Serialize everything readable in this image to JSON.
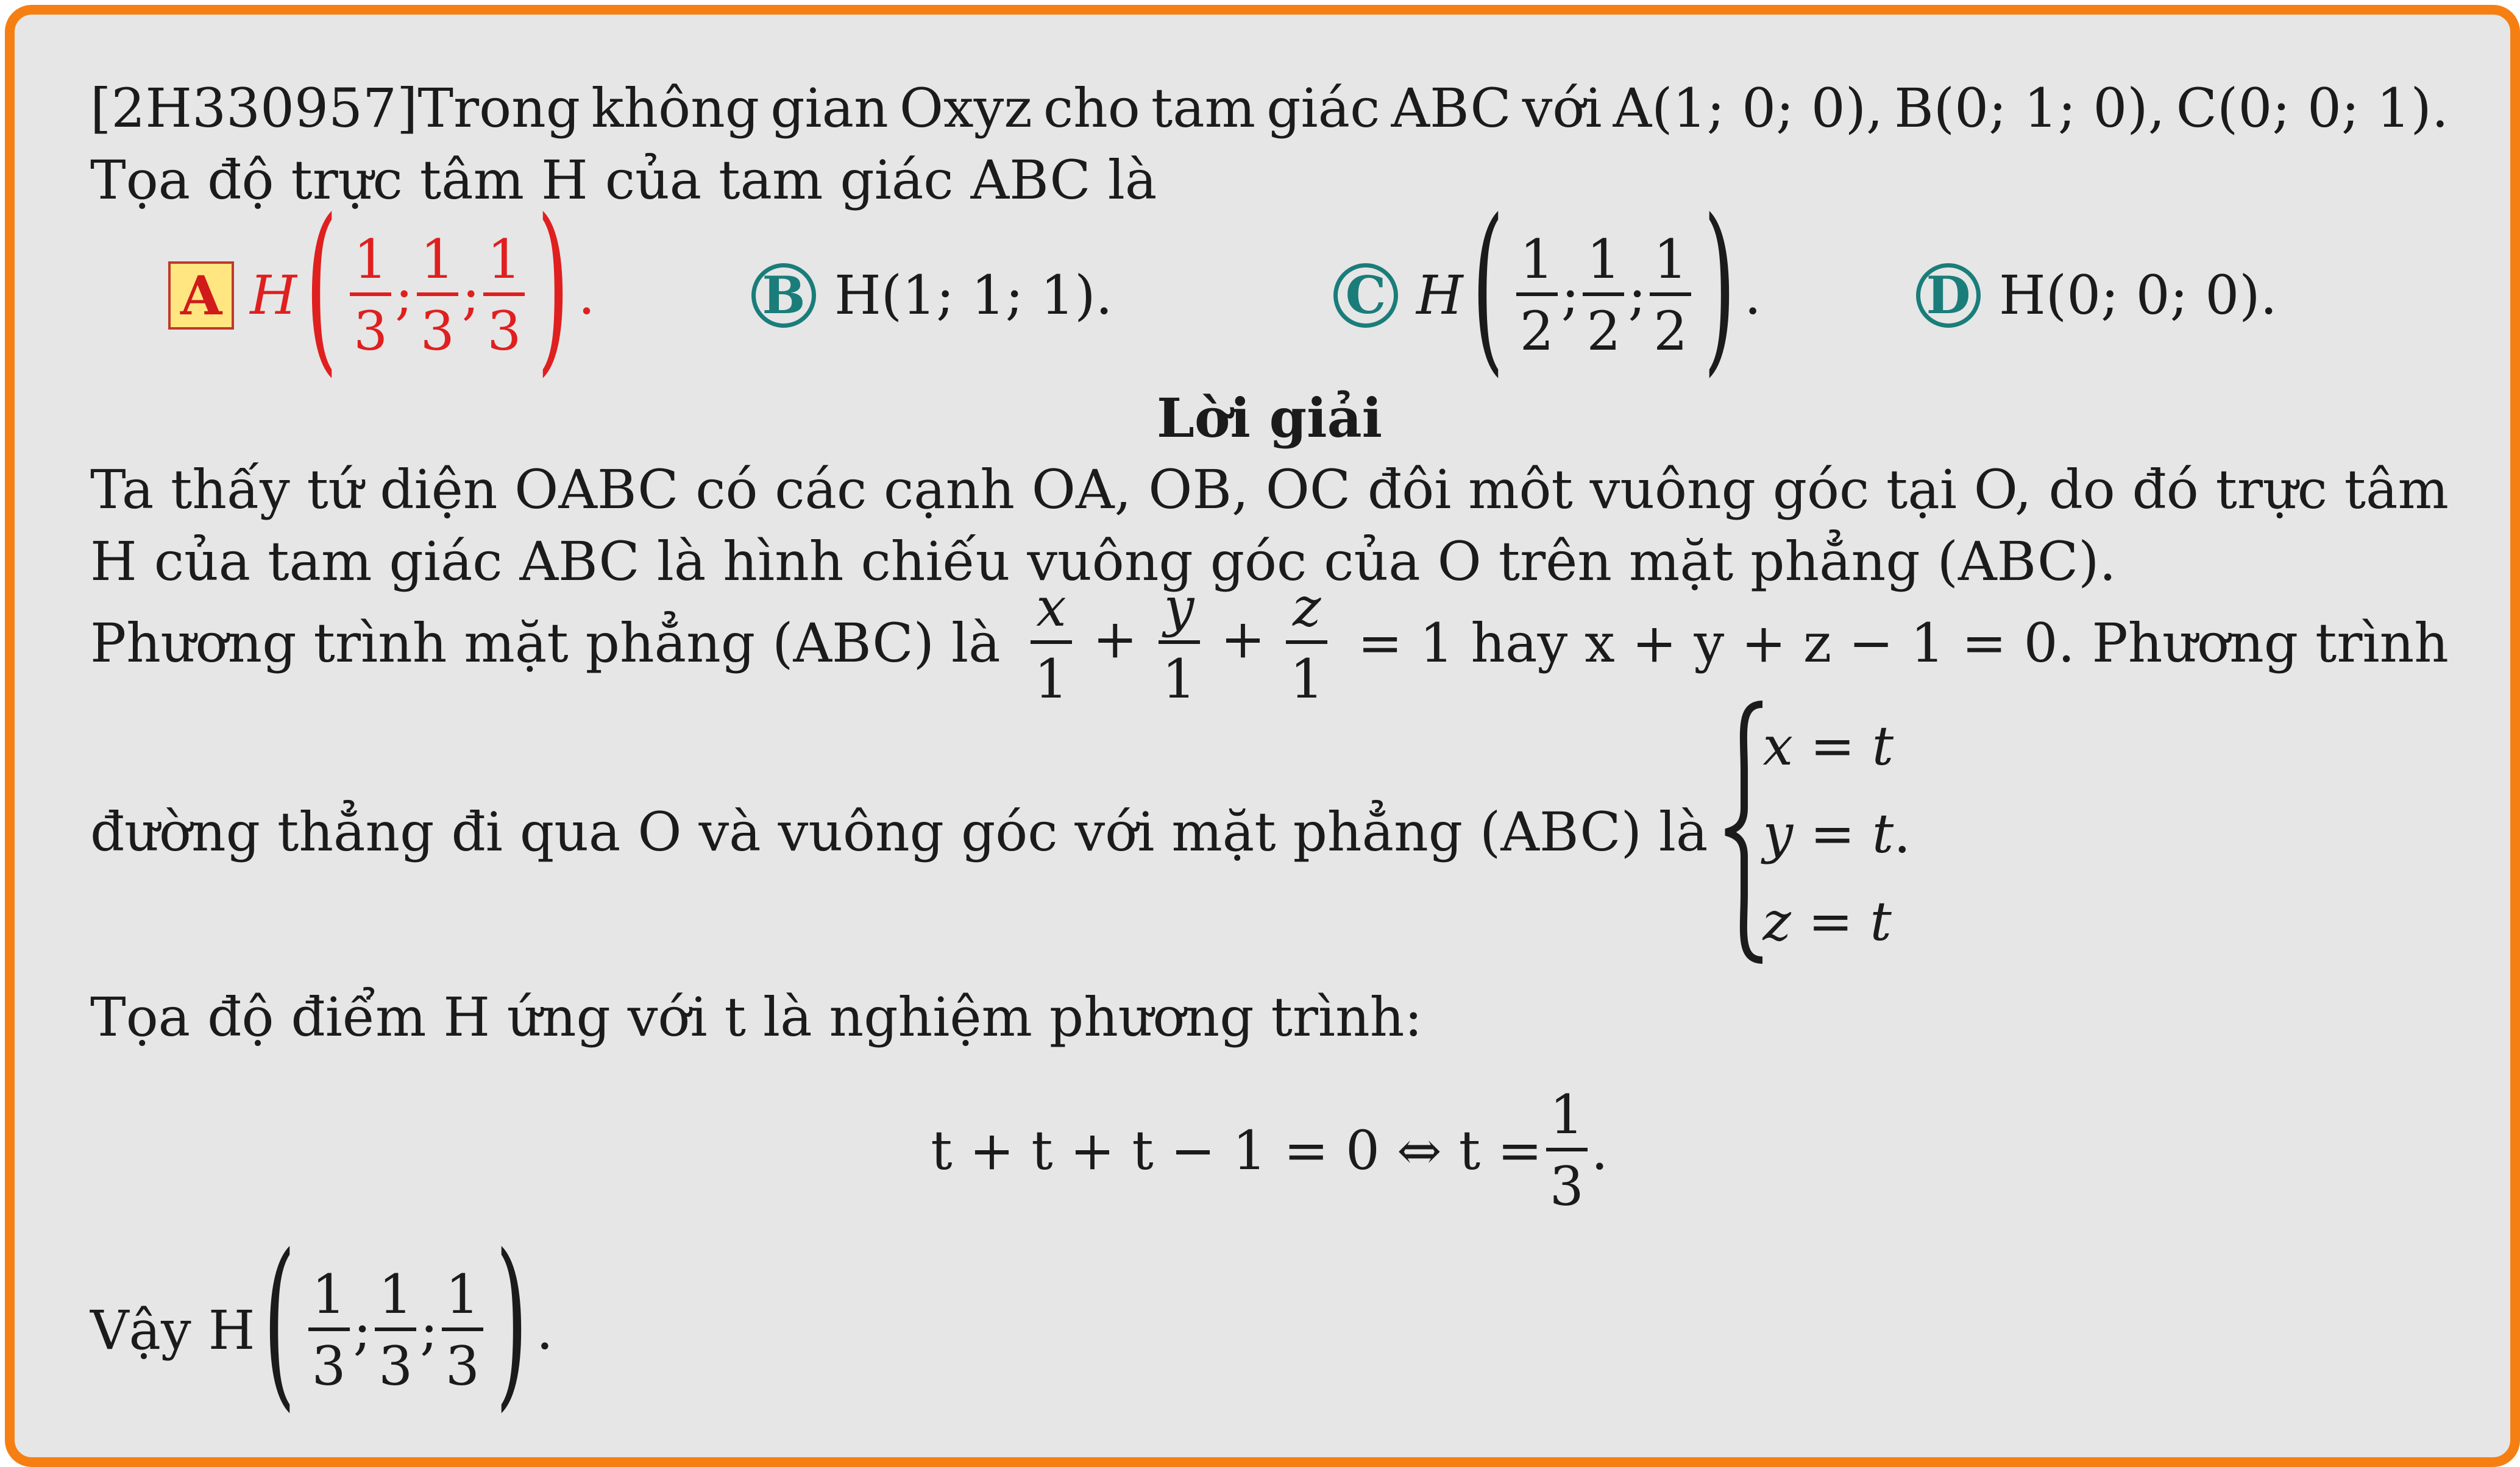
{
  "problem": {
    "code": "[2H330957]",
    "line1": [
      "Trong",
      "không",
      "gian",
      "Oxyz",
      "cho",
      "tam",
      "giác",
      "ABC",
      "với",
      "A(1; 0; 0),",
      "B(0; 1; 0),",
      "C(0; 0; 1)."
    ],
    "line2": "Tọa độ trực tâm H của tam giác ABC là"
  },
  "choices": [
    {
      "label": "A",
      "prefix": "H",
      "num": [
        "1",
        "1",
        "1"
      ],
      "den": [
        "3",
        "3",
        "3"
      ],
      "suffix": ".",
      "correct": true
    },
    {
      "label": "B",
      "text": "H(1; 1; 1).",
      "correct": false
    },
    {
      "label": "C",
      "prefix": "H",
      "num": [
        "1",
        "1",
        "1"
      ],
      "den": [
        "2",
        "2",
        "2"
      ],
      "suffix": ".",
      "correct": false
    },
    {
      "label": "D",
      "text": "H(0; 0; 0).",
      "correct": false
    }
  ],
  "solution": {
    "heading": "Lời giải",
    "p1_line1": [
      "Ta",
      "thấy",
      "tứ",
      "diện",
      "OABC",
      "có",
      "các",
      "cạnh",
      "OA,",
      "OB,",
      "OC",
      "đôi",
      "môt",
      "vuông",
      "góc",
      "tại",
      "O,",
      "do",
      "đó",
      "trực",
      "tâm"
    ],
    "p1_line2": "H của tam giác ABC là hình chiếu vuông góc của O trên mặt phẳng (ABC).",
    "p2_lead": "Phương trình mặt phẳng (ABC) là",
    "plane_fracs": [
      {
        "n": "x",
        "d": "1"
      },
      {
        "n": "y",
        "d": "1"
      },
      {
        "n": "z",
        "d": "1"
      }
    ],
    "p2_mid": "= 1 hay x + y + z − 1 = 0. Phương trình",
    "p3_lead": "đường thẳng đi qua O và vuông góc với mặt phẳng (ABC) là",
    "system": [
      "x = t",
      "y = t",
      "z = t"
    ],
    "system_suffix": ".",
    "p4": "Tọa độ điểm H ứng với t là nghiệm phương trình:",
    "equation_lead": "t + t + t − 1 = 0 ⇔ t =",
    "equation_frac": {
      "n": "1",
      "d": "3"
    },
    "equation_suffix": ".",
    "conclusion_lead": "Vậy H",
    "conclusion_num": [
      "1",
      "1",
      "1"
    ],
    "conclusion_den": [
      "3",
      "3",
      "3"
    ],
    "conclusion_suffix": "."
  },
  "colors": {
    "border": "#f57f12",
    "background": "#e6e6e6",
    "correct": "#e01f1f",
    "badge": "#1a7d7a",
    "highlight": "#ffe680"
  }
}
